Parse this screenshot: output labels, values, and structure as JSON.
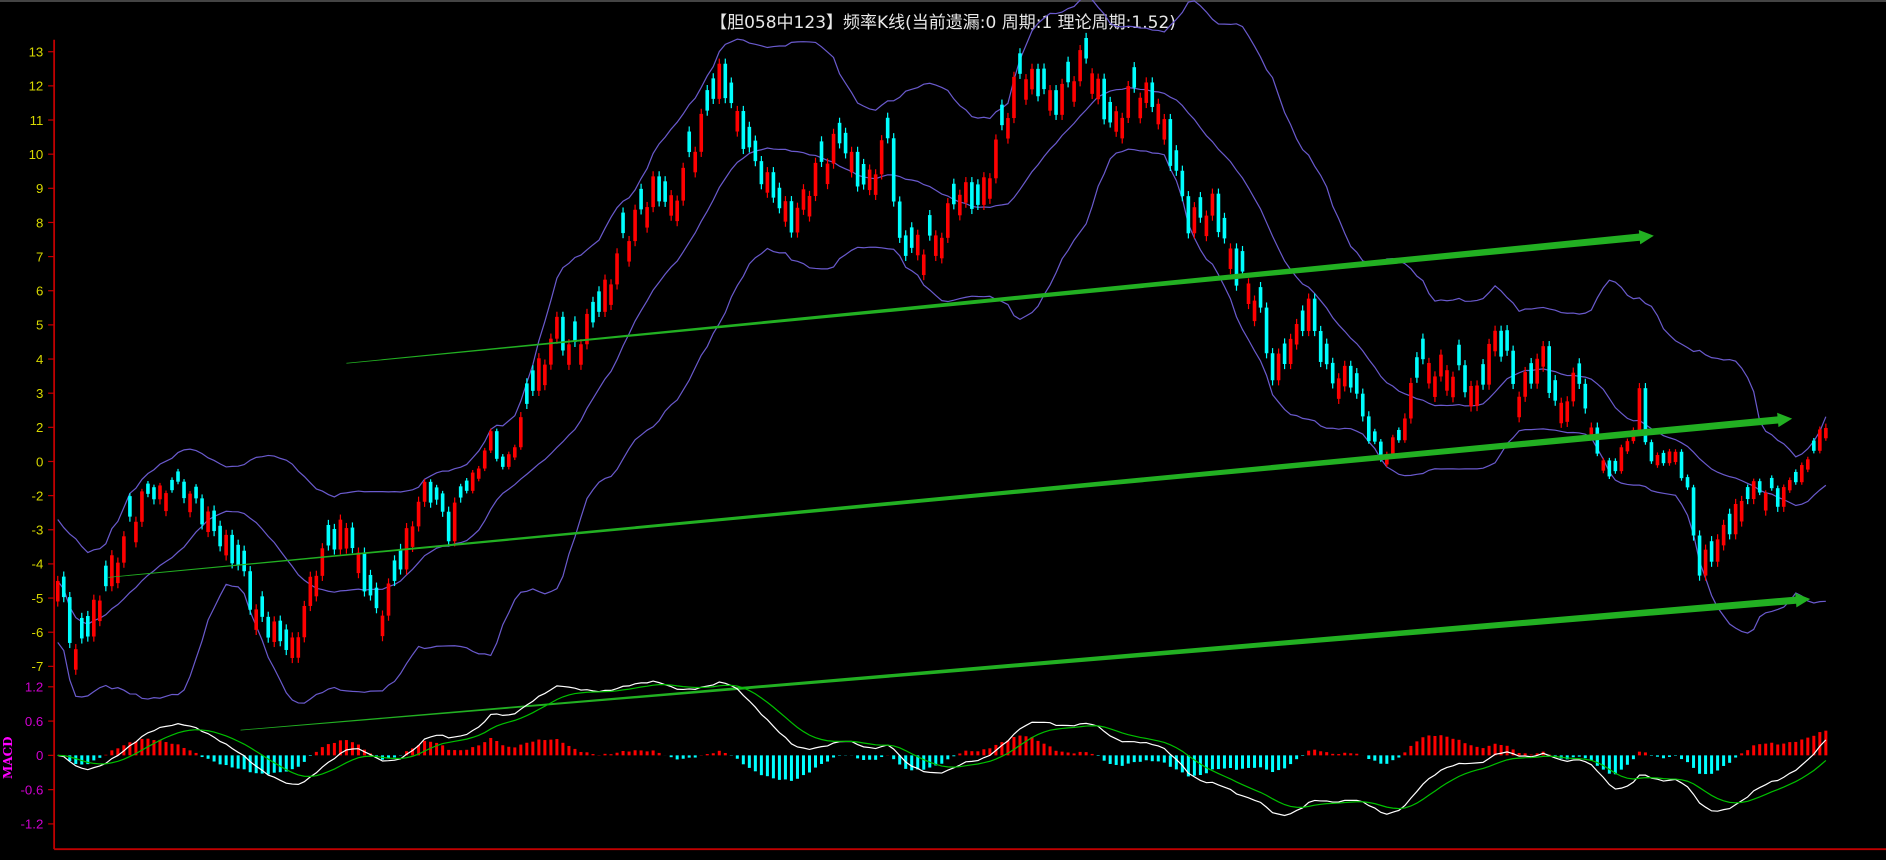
{
  "header": {
    "title": "【胆058中123】频率K线(当前遗漏:0 周期:1 理论周期:1.52)"
  },
  "chart_data": [
    {
      "type": "candlestick",
      "title": "频率K线",
      "y_tick_labels": [
        "13",
        "12",
        "11",
        "10",
        "9",
        "8",
        "7",
        "6",
        "5",
        "4",
        "3",
        "2",
        "0",
        "-2",
        "-3",
        "-4",
        "-5",
        "-6",
        "-7"
      ],
      "colors": {
        "up": "#ff0000",
        "down": "#00ffff",
        "bands": "#6a5acd",
        "trend_arrows": "#22b022"
      },
      "close_path": [
        [
          0,
          -4.5
        ],
        [
          3,
          -6.7
        ],
        [
          8,
          -4.5
        ],
        [
          14,
          -2
        ],
        [
          20,
          -1.5
        ],
        [
          24,
          -2.5
        ],
        [
          30,
          -4
        ],
        [
          33,
          -5.5
        ],
        [
          39,
          -6.5
        ],
        [
          43,
          -4
        ],
        [
          48,
          -2.8
        ],
        [
          50,
          -4
        ],
        [
          53,
          -5.5
        ],
        [
          56,
          -4.5
        ],
        [
          61,
          -1.5
        ],
        [
          65,
          -3
        ],
        [
          69,
          -1
        ],
        [
          72,
          1.5
        ],
        [
          74,
          -0.5
        ],
        [
          78,
          2.8
        ],
        [
          83,
          5
        ],
        [
          85,
          4.2
        ],
        [
          90,
          5.5
        ],
        [
          94,
          7.5
        ],
        [
          99,
          9
        ],
        [
          102,
          8.5
        ],
        [
          110,
          12.3
        ],
        [
          112,
          11.5
        ],
        [
          115,
          10
        ],
        [
          122,
          8
        ],
        [
          126,
          9.5
        ],
        [
          130,
          10.5
        ],
        [
          134,
          9
        ],
        [
          138,
          10.5
        ],
        [
          140,
          7.2
        ],
        [
          146,
          7.5
        ],
        [
          150,
          9
        ],
        [
          153,
          8.5
        ],
        [
          160,
          12.5
        ],
        [
          163,
          12
        ],
        [
          166,
          11.5
        ],
        [
          171,
          13
        ],
        [
          175,
          10.8
        ],
        [
          179,
          12
        ],
        [
          183,
          11.5
        ],
        [
          185,
          10
        ],
        [
          188,
          8
        ],
        [
          192,
          8.5
        ],
        [
          196,
          6.5
        ],
        [
          199,
          6
        ],
        [
          202,
          3.5
        ],
        [
          208,
          5.5
        ],
        [
          211,
          3.5
        ],
        [
          215,
          3.5
        ],
        [
          220,
          0.2
        ],
        [
          223,
          1.5
        ],
        [
          226,
          3.8
        ],
        [
          231,
          3.8
        ],
        [
          236,
          3
        ],
        [
          239,
          4.8
        ],
        [
          243,
          3
        ],
        [
          247,
          4.2
        ],
        [
          249,
          2.5
        ],
        [
          253,
          3.5
        ],
        [
          258,
          -1
        ],
        [
          263,
          2.8
        ],
        [
          265,
          0
        ],
        [
          269,
          0.5
        ],
        [
          273,
          -4.2
        ],
        [
          279,
          -2.5
        ],
        [
          282,
          -1.5
        ],
        [
          286,
          -2
        ],
        [
          290,
          -0.5
        ],
        [
          294,
          2.2
        ]
      ],
      "indicators": [
        "Bollinger upper",
        "Bollinger middle",
        "Bollinger lower"
      ]
    },
    {
      "type": "bar+line",
      "title": "MACD",
      "y_tick_labels": [
        "1.2",
        "0.6",
        "0",
        "-0.6",
        "-1.2"
      ],
      "ylim": [
        -1.2,
        1.2
      ],
      "series": [
        {
          "name": "DIF",
          "color": "#ffffff"
        },
        {
          "name": "DEA",
          "color": "#00c000"
        },
        {
          "name": "MACD histogram",
          "color_pos": "#ff0000",
          "color_neg": "#00ffff"
        }
      ]
    }
  ]
}
